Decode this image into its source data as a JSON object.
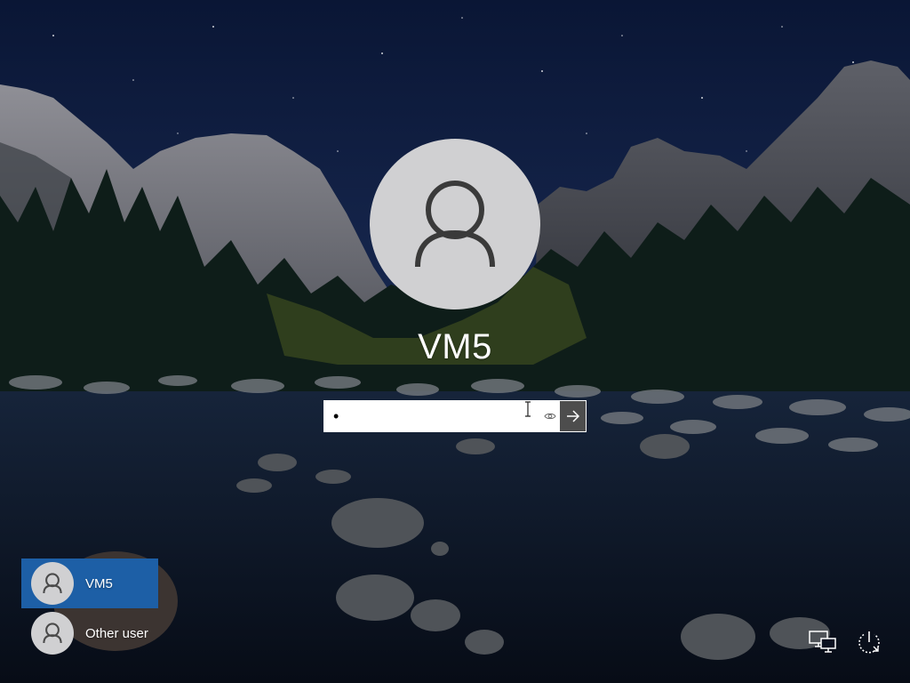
{
  "login": {
    "username": "VM5",
    "password_value": "•",
    "password_placeholder": ""
  },
  "icons": {
    "avatar": "user-silhouette-icon",
    "reveal": "eye-icon",
    "submit": "arrow-right-icon",
    "network": "network-icon",
    "power": "power-icon"
  },
  "user_list": [
    {
      "label": "VM5",
      "selected": true
    },
    {
      "label": "Other user",
      "selected": false
    }
  ],
  "colors": {
    "selected_tile": "#1d5fa6",
    "submit_button": "#4d4d4d",
    "avatar_bg": "#d0d0d2"
  }
}
